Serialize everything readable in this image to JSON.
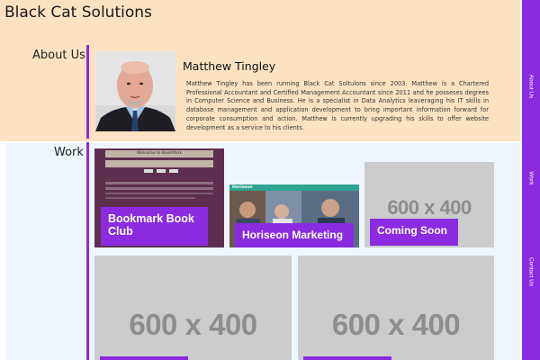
{
  "header": {
    "brand": "Black Cat Solutions"
  },
  "nav": {
    "items": [
      "About Us",
      "Work",
      "Contact Us"
    ]
  },
  "about": {
    "heading": "About Us",
    "name": "Matthew Tingley",
    "bio": "Matthew Tingley has been running Black Cat Soltulons since 2003. Matthew is a Chartered Professional Accountant and Certified Management Accountant since 2011 and he posseses degrees in Computer Science and Business. He is a specialist in Data Analytics leaveraging his IT skills in database management and application development to bring important information forward for corporate consumption and action. Matthew is currently upgrading his skills to offer website development as a service to his clients."
  },
  "work": {
    "heading": "Work",
    "projects": [
      {
        "title": "Bookmark Book Club"
      },
      {
        "title": "Horiseon Marketing"
      },
      {
        "title": "Coming Soon",
        "placeholder": "600 x 400"
      },
      {
        "title": "",
        "placeholder": "600 x 400"
      },
      {
        "title": "",
        "placeholder": "600 x 400"
      }
    ],
    "bookmark_screenshot": {
      "heading": "Welcome to BookMark"
    },
    "horiseon_screenshot": {
      "brand": "Horiseon"
    }
  },
  "colors": {
    "accent": "#8a2be2",
    "header_bg": "#fde2c1",
    "work_bg": "#eef5fd",
    "placeholder_bg": "#cccccc"
  }
}
